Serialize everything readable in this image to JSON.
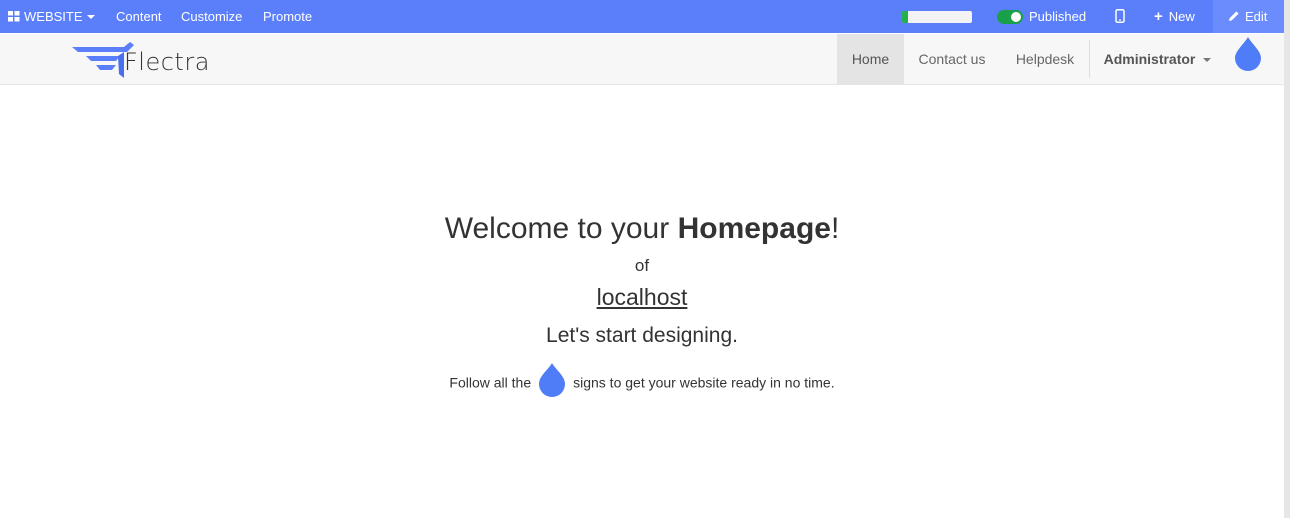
{
  "admin_bar": {
    "website_label": "WEBSITE",
    "content_label": "Content",
    "customize_label": "Customize",
    "promote_label": "Promote",
    "progress_fraction": 0.08,
    "published_label": "Published",
    "new_label": "New",
    "edit_label": "Edit"
  },
  "site_nav": {
    "logo_text": "Flectra",
    "items": [
      {
        "label": "Home",
        "active": true
      },
      {
        "label": "Contact us",
        "active": false
      },
      {
        "label": "Helpdesk",
        "active": false
      }
    ],
    "user_label": "Administrator"
  },
  "main": {
    "welcome_prefix": "Welcome to your ",
    "welcome_bold": "Homepage",
    "welcome_suffix": "!",
    "of": "of",
    "host": "localhost",
    "start": "Let's start designing.",
    "follow_prefix": "Follow all the",
    "follow_suffix": "signs to get your website ready in no time."
  },
  "colors": {
    "admin_bar_bg": "#5b7ffb",
    "accent_drop": "#4f7cf7",
    "toggle_on": "#1aa04a",
    "progress_fill": "#22b14c"
  },
  "icons": [
    "grid-icon",
    "caret-down-icon",
    "toggle-icon",
    "mobile-icon",
    "plus-icon",
    "pencil-icon",
    "drop-icon",
    "flectra-logo"
  ]
}
